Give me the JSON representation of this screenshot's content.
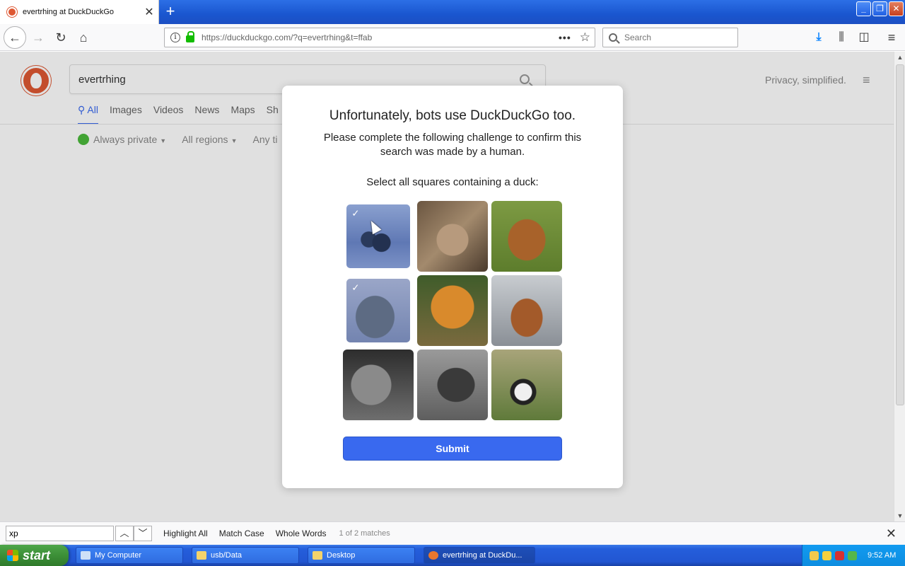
{
  "browser": {
    "tab_title": "evertrhing at DuckDuckGo",
    "tab_close": "✕",
    "new_tab": "+",
    "url_host": "https://duckduckgo.com",
    "url_path": "/?q=evertrhing&t=ffab",
    "url_dots": "•••",
    "search_placeholder": "Search"
  },
  "page": {
    "query": "evertrhing",
    "tagline": "Privacy, simplified.",
    "tabs": [
      "All",
      "Images",
      "Videos",
      "News",
      "Maps",
      "Sh"
    ],
    "filters": [
      "Always private",
      "All regions",
      "Any ti"
    ]
  },
  "modal": {
    "title": "Unfortunately, bots use DuckDuckGo too.",
    "subtitle": "Please complete the following challenge to confirm this search was made by a human.",
    "instruction": "Select all squares containing a duck:",
    "submit_label": "Submit",
    "check_mark": "✓",
    "tiles": [
      {
        "subject": "ducks",
        "selected": true
      },
      {
        "subject": "fox",
        "selected": false
      },
      {
        "subject": "moth",
        "selected": false
      },
      {
        "subject": "duck",
        "selected": true
      },
      {
        "subject": "tiger",
        "selected": false
      },
      {
        "subject": "grebe",
        "selected": false
      },
      {
        "subject": "lion",
        "selected": false
      },
      {
        "subject": "elephant",
        "selected": false
      },
      {
        "subject": "panda",
        "selected": false
      }
    ]
  },
  "findbar": {
    "value": "xp",
    "highlight_all": "Highlight All",
    "match_case": "Match Case",
    "whole_words": "Whole Words",
    "status": "1 of 2 matches"
  },
  "taskbar": {
    "start_label": "start",
    "tasks": [
      "My Computer",
      "usb/Data",
      "Desktop",
      "evertrhing at DuckDu..."
    ],
    "clock": "9:52 AM"
  }
}
